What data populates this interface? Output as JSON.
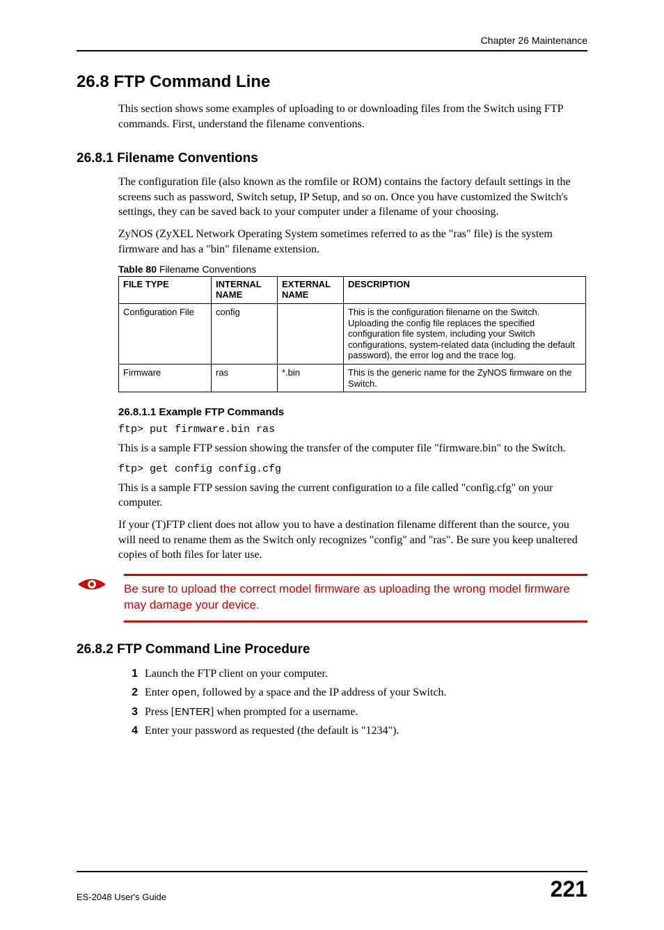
{
  "chapter_header": "Chapter 26 Maintenance",
  "section": {
    "h1": "26.8  FTP Command Line",
    "intro": "This section shows some examples of uploading to or downloading files from the Switch using FTP commands. First, understand the filename conventions.",
    "s1": {
      "title": "26.8.1  Filename Conventions",
      "p1": "The configuration file (also known as the romfile or ROM) contains the factory default settings in the screens such as password, Switch setup, IP Setup, and so on. Once you have customized the Switch's settings, they can be saved back to your computer under a filename of your choosing.",
      "p2": "ZyNOS (ZyXEL Network Operating System sometimes referred to as the \"ras\" file) is the system firmware and has a \"bin\" filename extension.",
      "table_caption_label": "Table 80",
      "table_caption_text": "   Filename Conventions",
      "table": {
        "headers": [
          "FILE TYPE",
          "INTERNAL NAME",
          "EXTERNAL NAME",
          "DESCRIPTION"
        ],
        "rows": [
          {
            "file_type": "Configuration File",
            "internal": "config",
            "external": "",
            "desc": "This is the configuration filename on the Switch. Uploading the config file replaces the specified configuration file system, including your Switch configurations, system-related data (including the default password), the error log and the trace log."
          },
          {
            "file_type": "Firmware",
            "internal": "ras",
            "external": "*.bin",
            "desc": "This is the generic name for the ZyNOS firmware on the Switch."
          }
        ]
      },
      "s11": {
        "title": "26.8.1.1  Example FTP Commands",
        "cmd1": "ftp> put firmware.bin ras",
        "p1": "This is a sample FTP session showing the transfer of the computer file \"firmware.bin\" to the Switch.",
        "cmd2": "ftp> get config config.cfg",
        "p2": "This is a sample FTP session saving the current configuration to a file called \"config.cfg\" on your computer.",
        "p3": "If your (T)FTP client does not allow you to have a destination filename different than the source, you will need to rename them as the Switch only recognizes \"config\" and \"ras\". Be sure you keep unaltered copies of both files for later use."
      },
      "warning": "Be sure to upload the correct model firmware as uploading the wrong model firmware may damage your device."
    },
    "s2": {
      "title": "26.8.2  FTP Command Line Procedure",
      "steps": {
        "n1": "1",
        "t1": "Launch the FTP client on your computer.",
        "n2": "2",
        "t2a": "Enter ",
        "t2_mono": "open",
        "t2b": ", followed by a space and the IP address of your Switch.",
        "n3": "3",
        "t3a": "Press [",
        "t3_key": "ENTER",
        "t3b": "] when prompted for a username.",
        "n4": "4",
        "t4": "Enter your password as requested (the default is \"1234\")."
      }
    }
  },
  "footer": {
    "left": "ES-2048 User's Guide",
    "page": "221"
  }
}
